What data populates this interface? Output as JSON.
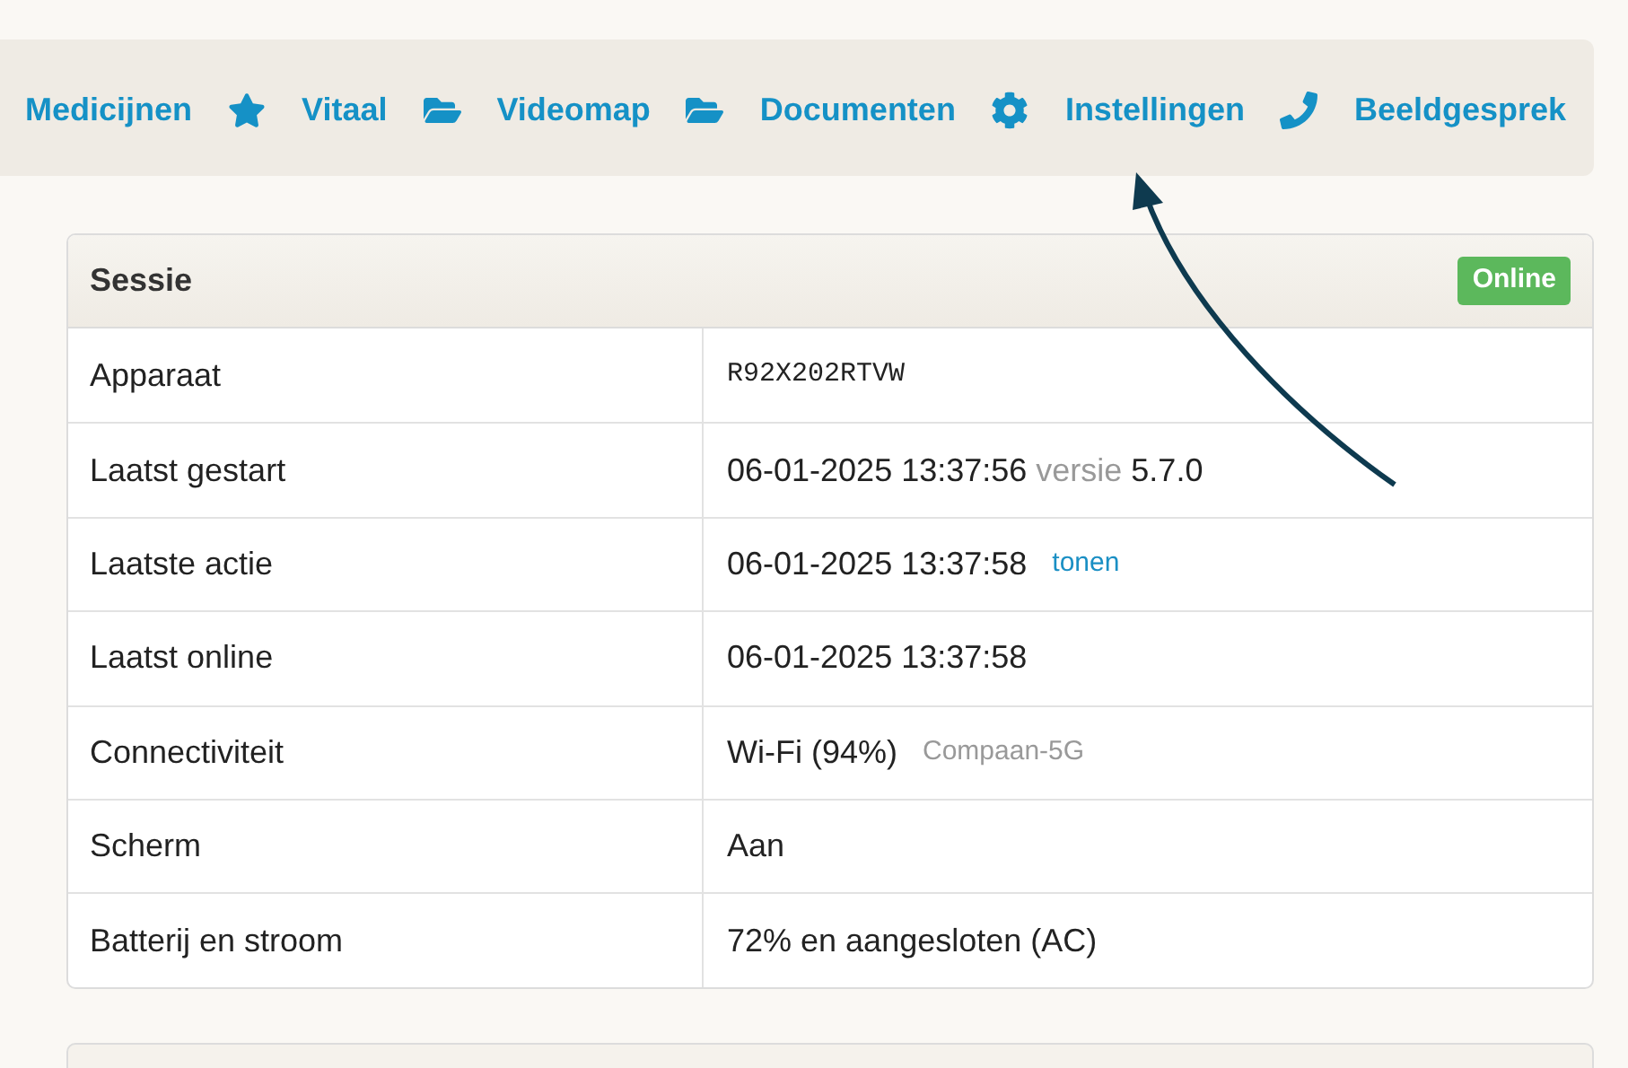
{
  "nav": [
    {
      "label": "Medicijnen"
    },
    {
      "label": "Vitaal"
    },
    {
      "label": "Videomap"
    },
    {
      "label": "Documenten"
    },
    {
      "label": "Instellingen"
    },
    {
      "label": "Beeldgesprek"
    }
  ],
  "session": {
    "title": "Sessie",
    "status": "Online",
    "rows": [
      {
        "label": "Apparaat",
        "value": [
          {
            "text": "R92X202RTVW",
            "kind": "mono"
          }
        ]
      },
      {
        "label": "Laatst gestart",
        "value": [
          {
            "text": "06-01-2025 13:37:56",
            "kind": "plain"
          },
          {
            "text": "versie",
            "kind": "muted"
          },
          {
            "text": "5.7.0",
            "kind": "plain"
          }
        ]
      },
      {
        "label": "Laatste actie",
        "value": [
          {
            "text": "06-01-2025 13:37:58",
            "kind": "plain"
          },
          {
            "text": "tonen",
            "kind": "link"
          }
        ]
      },
      {
        "label": "Laatst online",
        "value": [
          {
            "text": "06-01-2025 13:37:58",
            "kind": "plain"
          }
        ]
      },
      {
        "label": "Connectiviteit",
        "value": [
          {
            "text": "Wi-Fi (94%)",
            "kind": "plain"
          },
          {
            "text": "Compaan-5G",
            "kind": "muted"
          }
        ]
      },
      {
        "label": "Scherm",
        "value": [
          {
            "text": "Aan",
            "kind": "plain"
          }
        ]
      },
      {
        "label": "Batterij en stroom",
        "value": [
          {
            "text": "72% en aangesloten (AC)",
            "kind": "plain"
          }
        ]
      }
    ]
  }
}
